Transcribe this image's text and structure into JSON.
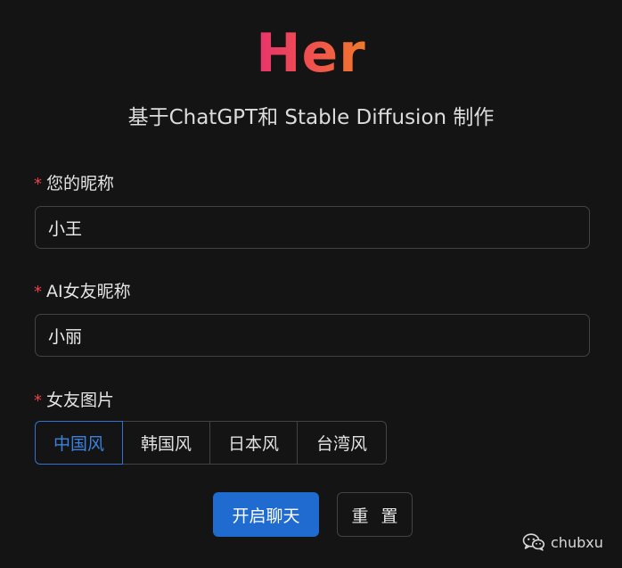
{
  "header": {
    "title": "Her",
    "subtitle": "基于ChatGPT和 Stable Diffusion 制作"
  },
  "form": {
    "required_mark": "*",
    "nickname": {
      "label": "您的昵称",
      "value": "小王"
    },
    "ai_nickname": {
      "label": "AI女友昵称",
      "value": "小丽"
    },
    "girlfriend_image": {
      "label": "女友图片",
      "options": [
        "中国风",
        "韩国风",
        "日本风",
        "台湾风"
      ],
      "selected": "中国风"
    }
  },
  "actions": {
    "start_label": "开启聊天",
    "reset_label": "重 置"
  },
  "watermark": {
    "text": "chubxu",
    "icon": "wechat-icon"
  },
  "colors": {
    "background": "#141414",
    "primary": "#1f6bd0",
    "required": "#e8414b",
    "title_gradient": [
      "#e8336d",
      "#f07a2a"
    ]
  }
}
